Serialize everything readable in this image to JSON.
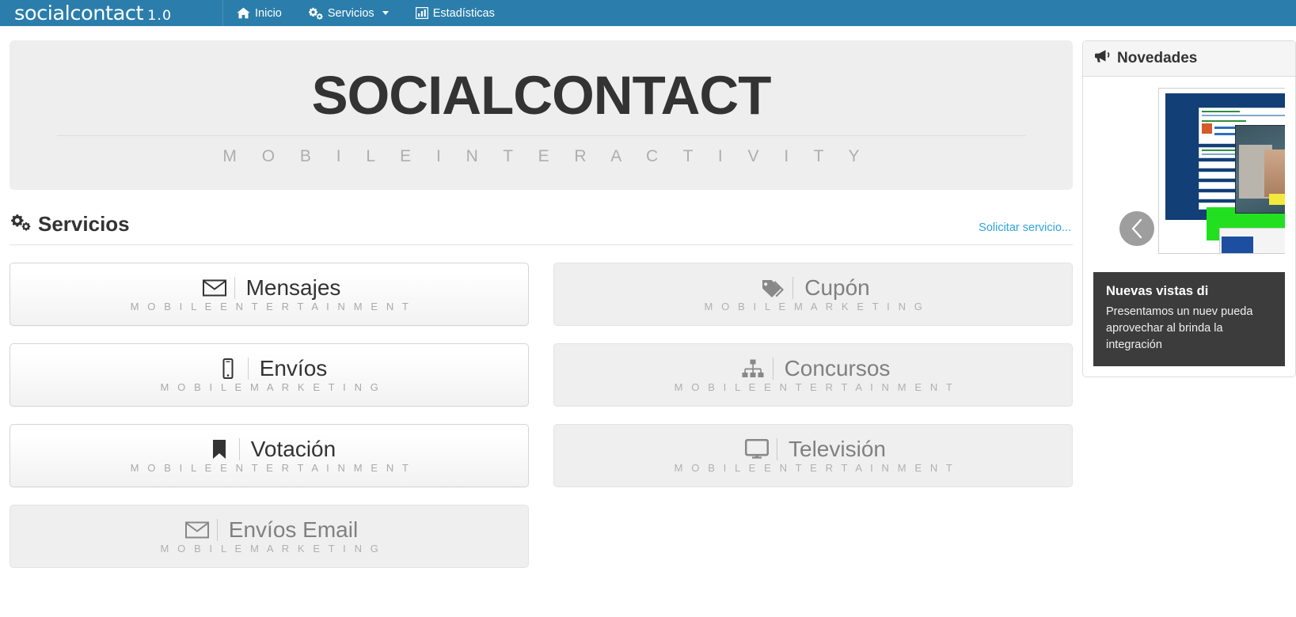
{
  "navbar": {
    "brand": "socialcontact",
    "brand_version": "1.0",
    "brand_color": "#2b7eab",
    "items": [
      {
        "label": "Inicio",
        "icon": "home-icon"
      },
      {
        "label": "Servicios",
        "icon": "gears-icon",
        "has_caret": true
      },
      {
        "label": "Estadísticas",
        "icon": "bar-chart-icon"
      }
    ]
  },
  "jumbotron": {
    "title": "SOCIALCONTACT",
    "subtitle": "M O B I L E   I N T E R A C T I V I T Y"
  },
  "services_section": {
    "title": "Servicios",
    "icon": "gears-icon",
    "link": "Solicitar servicio...",
    "link_color": "#2fa3e0"
  },
  "services": {
    "left": [
      {
        "label": "Mensajes",
        "category": "M O B I L E   E N T E R T A I N M E N T",
        "icon": "envelope-icon",
        "enabled": true
      },
      {
        "label": "Envíos",
        "category": "M O B I L E   M A R K E T I N G",
        "icon": "mobile-icon",
        "enabled": true
      },
      {
        "label": "Votación",
        "category": "M O B I L E   E N T E R T A I N M E N T",
        "icon": "bookmark-icon",
        "enabled": true
      },
      {
        "label": "Envíos Email",
        "category": "M O B I L E   M A R K E T I N G",
        "icon": "envelope-icon",
        "enabled": false
      }
    ],
    "right": [
      {
        "label": "Cupón",
        "category": "M O B I L E   M A R K E T I N G",
        "icon": "tags-icon",
        "enabled": false
      },
      {
        "label": "Concursos",
        "category": "M O B I L E   E N T E R T A I N M E N T",
        "icon": "sitemap-icon",
        "enabled": false
      },
      {
        "label": "Televisión",
        "category": "M O B I L E   E N T E R T A I N M E N T",
        "icon": "desktop-icon",
        "enabled": false
      }
    ]
  },
  "sidebar": {
    "panel_title": "Novedades",
    "panel_icon": "bullhorn-icon",
    "carousel": {
      "prev_label": "‹"
    },
    "news": {
      "title": "Nuevas vistas di",
      "body": "Presentamos un nuev pueda aprovechar al brinda la integración"
    }
  }
}
